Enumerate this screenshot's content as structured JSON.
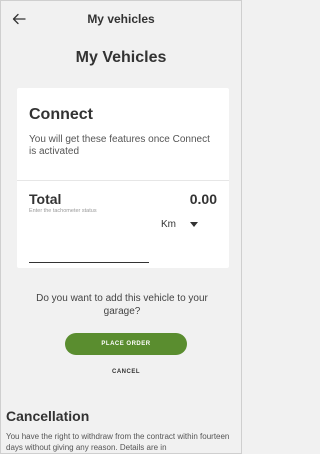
{
  "header": {
    "title": "My vehicles",
    "back_icon": "arrow-left-icon"
  },
  "page": {
    "title": "My Vehicles"
  },
  "connect_card": {
    "title": "Connect",
    "description": "You will get these features once Connect is activated"
  },
  "total_card": {
    "label": "Total",
    "value": "0.00",
    "hint": "Enter the tachometer status",
    "unit": "Km",
    "input_value": ""
  },
  "prompt": {
    "question": "Do you want to add this vehicle to your garage?",
    "place_order_label": "PLACE ORDER",
    "cancel_label": "CANCEL"
  },
  "cancellation": {
    "title": "Cancellation",
    "text": "You have the right to withdraw from the contract within fourteen days without giving any reason. Details are in"
  },
  "colors": {
    "accent": "#5a8d2f",
    "background": "#f1f1f1"
  }
}
